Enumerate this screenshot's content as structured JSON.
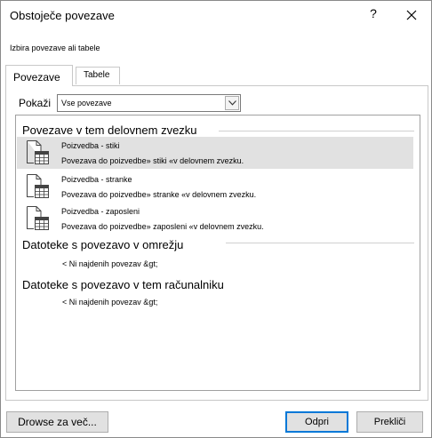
{
  "dialog": {
    "title": "Obstoječe povezave",
    "help_label": "?",
    "subtitle": "Izbira povezave ali tabele"
  },
  "tabs": [
    {
      "label": "Povezave",
      "active": true
    },
    {
      "label": "Tabele",
      "active": false
    }
  ],
  "filter": {
    "label": "Pokaži",
    "selected": "Vse povezave"
  },
  "groups": [
    {
      "header": "Povezave v tem delovnem zvezku",
      "items": [
        {
          "name": "Poizvedba - stiki",
          "description": "Povezava do poizvedbe» stiki «v delovnem zvezku.",
          "selected": true,
          "icon": "query-table-icon"
        },
        {
          "name": "Poizvedba - stranke",
          "description": "Povezava do poizvedbe» stranke «v delovnem zvezku.",
          "selected": false,
          "icon": "query-table-icon"
        },
        {
          "name": "Poizvedba - zaposleni",
          "description": "Povezava do poizvedbe» zaposleni «v delovnem zvezku.",
          "selected": false,
          "icon": "query-table-icon"
        }
      ]
    },
    {
      "header": "Datoteke s povezavo v omrežju",
      "empty_message": "< Ni najdenih povezav &gt;"
    },
    {
      "header": "Datoteke s povezavo v tem računalniku",
      "empty_message": "< Ni najdenih povezav &gt;"
    }
  ],
  "buttons": {
    "browse": "Drowse za več...",
    "open": "Odpri",
    "cancel": "Prekliči"
  },
  "colors": {
    "accent": "#0078d7",
    "selected_row": "#e1e1e1"
  }
}
